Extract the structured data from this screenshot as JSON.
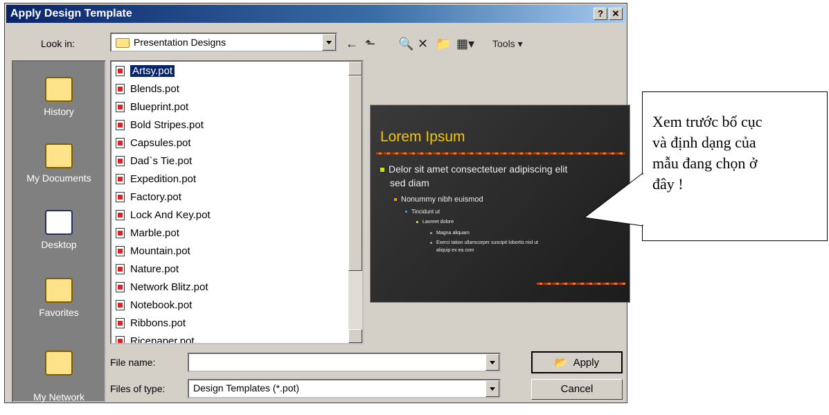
{
  "window": {
    "title": "Apply Design Template",
    "help_label": "?",
    "close_label": "✕"
  },
  "look_in": {
    "label": "Look in:",
    "value": "Presentation Designs"
  },
  "toolbar": {
    "tools_label": "Tools"
  },
  "places": [
    {
      "label": "History"
    },
    {
      "label": "My Documents"
    },
    {
      "label": "Desktop"
    },
    {
      "label": "Favorites"
    },
    {
      "label": "My Network\nPlaces"
    }
  ],
  "files": [
    "Artsy.pot",
    "Blends.pot",
    "Blueprint.pot",
    "Bold Stripes.pot",
    "Capsules.pot",
    "Dad`s Tie.pot",
    "Expedition.pot",
    "Factory.pot",
    "Lock And Key.pot",
    "Marble.pot",
    "Mountain.pot",
    "Nature.pot",
    "Network Blitz.pot",
    "Notebook.pot",
    "Ribbons.pot",
    "Ricepaper.pot"
  ],
  "selected_file": "Artsy.pot",
  "preview": {
    "title": "Lorem Ipsum",
    "lines": [
      "Delor sit amet consectetuer adipiscing elit",
      "sed diam",
      "Nonummy nibh euismod",
      "Tincidunt ut",
      "Laoreet dolore",
      "Magna aliquam",
      "Exerci tation ullamcorper suscipit lobortis nisl ut",
      "aliquip ex ea com"
    ]
  },
  "file_name": {
    "label": "File name:",
    "value": ""
  },
  "files_of_type": {
    "label": "Files of type:",
    "value": "Design Templates (*.pot)"
  },
  "buttons": {
    "apply": "Apply",
    "cancel": "Cancel"
  },
  "callout": {
    "text": "Xem trước bố cục\nvà định dạng của\nmẫu đang chọn ở\nđây !"
  }
}
